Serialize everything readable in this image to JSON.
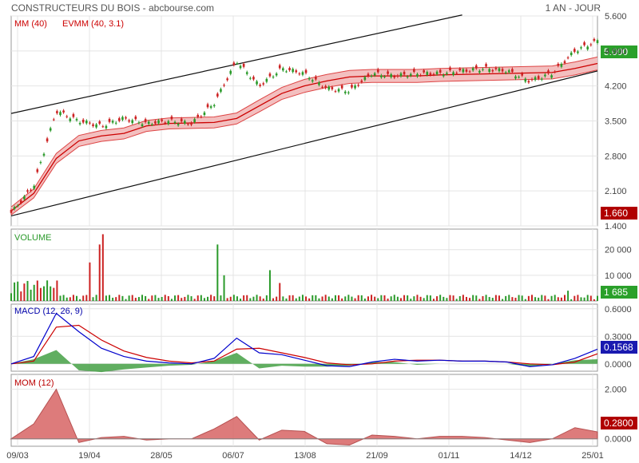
{
  "header": {
    "title": "CONSTRUCTEURS DU BOIS - abcbourse.com",
    "period": "1 AN - JOUR"
  },
  "colors": {
    "up": "#2a9a2a",
    "down": "#cc2222",
    "band": "#f2b8b8",
    "macd": "#0000cc",
    "signal": "#cc0000",
    "histogram": "#44a044",
    "momentum": "#d86464",
    "volume_badge": "#2aa02a",
    "price_badge": "#b00000"
  },
  "chart_data": [
    {
      "type": "line",
      "panel": "price",
      "legend": [
        "MM (40)",
        "EVMM (40, 3.1)"
      ],
      "ylim": [
        1.4,
        5.6
      ],
      "yticks": [
        "5.600",
        "4.900",
        "4.200",
        "3.500",
        "2.800",
        "2.100",
        "1.400"
      ],
      "ytick_values": [
        5.6,
        4.9,
        4.2,
        3.5,
        2.8,
        2.1,
        1.4
      ],
      "xticks": [
        "09/03",
        "19/04",
        "28/05",
        "06/07",
        "13/08",
        "21/09",
        "01/11",
        "14/12",
        "25/01"
      ],
      "x": [
        0,
        10,
        20,
        30,
        40,
        50,
        60,
        70,
        80,
        90,
        100,
        110,
        120,
        130,
        140,
        150,
        160,
        170,
        180,
        190,
        200,
        210,
        220,
        230,
        240,
        250,
        260
      ],
      "series": [
        {
          "name": "MM (40)",
          "values": [
            1.7,
            2.05,
            2.75,
            3.1,
            3.2,
            3.25,
            3.4,
            3.45,
            3.46,
            3.47,
            3.55,
            3.8,
            4.05,
            4.2,
            4.3,
            4.38,
            4.4,
            4.4,
            4.4,
            4.42,
            4.43,
            4.44,
            4.45,
            4.46,
            4.47,
            4.55,
            4.65
          ]
        },
        {
          "name": "EVMM upper",
          "values": [
            1.78,
            2.14,
            2.85,
            3.21,
            3.31,
            3.36,
            3.51,
            3.56,
            3.57,
            3.58,
            3.66,
            3.92,
            4.17,
            4.33,
            4.43,
            4.51,
            4.53,
            4.53,
            4.53,
            4.55,
            4.56,
            4.57,
            4.58,
            4.59,
            4.6,
            4.68,
            4.78
          ]
        },
        {
          "name": "EVMM lower",
          "values": [
            1.62,
            1.96,
            2.65,
            2.99,
            3.09,
            3.14,
            3.29,
            3.34,
            3.35,
            3.36,
            3.44,
            3.68,
            3.93,
            4.07,
            4.17,
            4.25,
            4.27,
            4.27,
            4.27,
            4.29,
            4.3,
            4.31,
            4.32,
            4.33,
            4.34,
            4.42,
            4.52
          ]
        },
        {
          "name": "close",
          "values": [
            1.66,
            2.2,
            3.7,
            3.5,
            3.4,
            3.55,
            3.45,
            3.5,
            3.45,
            3.85,
            4.7,
            4.2,
            4.55,
            4.45,
            4.15,
            4.1,
            4.45,
            4.4,
            4.45,
            4.45,
            4.5,
            4.55,
            4.5,
            4.3,
            4.45,
            4.9,
            5.1
          ]
        }
      ],
      "trendlines": [
        {
          "from": [
            0,
            3.65
          ],
          "to": [
            200,
            5.62
          ]
        },
        {
          "from": [
            0,
            1.6
          ],
          "to": [
            260,
            4.5
          ]
        }
      ],
      "annotations": [
        "5.000",
        "1.660"
      ]
    },
    {
      "type": "bar",
      "panel": "volume",
      "title": "VOLUME",
      "yticks": [
        "20 000",
        "10 000"
      ],
      "ytick_values": [
        20000,
        10000
      ],
      "ylim": [
        0,
        28000
      ],
      "annotation": "1 685"
    },
    {
      "type": "line",
      "panel": "macd",
      "title": "MACD (12, 26, 9)",
      "yticks": [
        "0.6000",
        "0.3000",
        "0.0000"
      ],
      "ytick_values": [
        0.6,
        0.3,
        0.0
      ],
      "ylim": [
        -0.08,
        0.65
      ],
      "x": [
        0,
        10,
        20,
        30,
        40,
        50,
        60,
        70,
        80,
        90,
        100,
        110,
        120,
        130,
        140,
        150,
        160,
        170,
        180,
        190,
        200,
        210,
        220,
        230,
        240,
        250,
        260
      ],
      "series": [
        {
          "name": "MACD",
          "values": [
            0.0,
            0.08,
            0.55,
            0.35,
            0.17,
            0.08,
            0.03,
            0.01,
            0.0,
            0.06,
            0.28,
            0.12,
            0.1,
            0.04,
            -0.02,
            -0.03,
            0.02,
            0.05,
            0.03,
            0.04,
            0.03,
            0.03,
            0.02,
            -0.03,
            -0.01,
            0.06,
            0.16
          ]
        },
        {
          "name": "signal",
          "values": [
            0.0,
            0.03,
            0.4,
            0.42,
            0.26,
            0.14,
            0.07,
            0.03,
            0.01,
            0.03,
            0.16,
            0.17,
            0.12,
            0.07,
            0.01,
            -0.01,
            0.0,
            0.03,
            0.04,
            0.04,
            0.03,
            0.03,
            0.02,
            0.0,
            -0.01,
            0.02,
            0.11
          ]
        }
      ],
      "annotation": "0.1568"
    },
    {
      "type": "area",
      "panel": "momentum",
      "title": "MOM (12)",
      "yticks": [
        "2.000",
        "0.0000"
      ],
      "ytick_values": [
        2.0,
        0.0
      ],
      "ylim": [
        -0.3,
        2.6
      ],
      "x": [
        0,
        10,
        20,
        30,
        40,
        50,
        60,
        70,
        80,
        90,
        100,
        110,
        120,
        130,
        140,
        150,
        160,
        170,
        180,
        190,
        200,
        210,
        220,
        230,
        240,
        250,
        260
      ],
      "values": [
        0.0,
        0.6,
        2.0,
        -0.15,
        0.05,
        0.1,
        -0.05,
        0.0,
        0.0,
        0.4,
        0.9,
        -0.05,
        0.35,
        0.3,
        -0.2,
        -0.25,
        0.15,
        0.1,
        0.0,
        0.1,
        0.1,
        0.05,
        -0.05,
        -0.15,
        0.0,
        0.45,
        0.28
      ],
      "annotation": "0.2800"
    }
  ]
}
